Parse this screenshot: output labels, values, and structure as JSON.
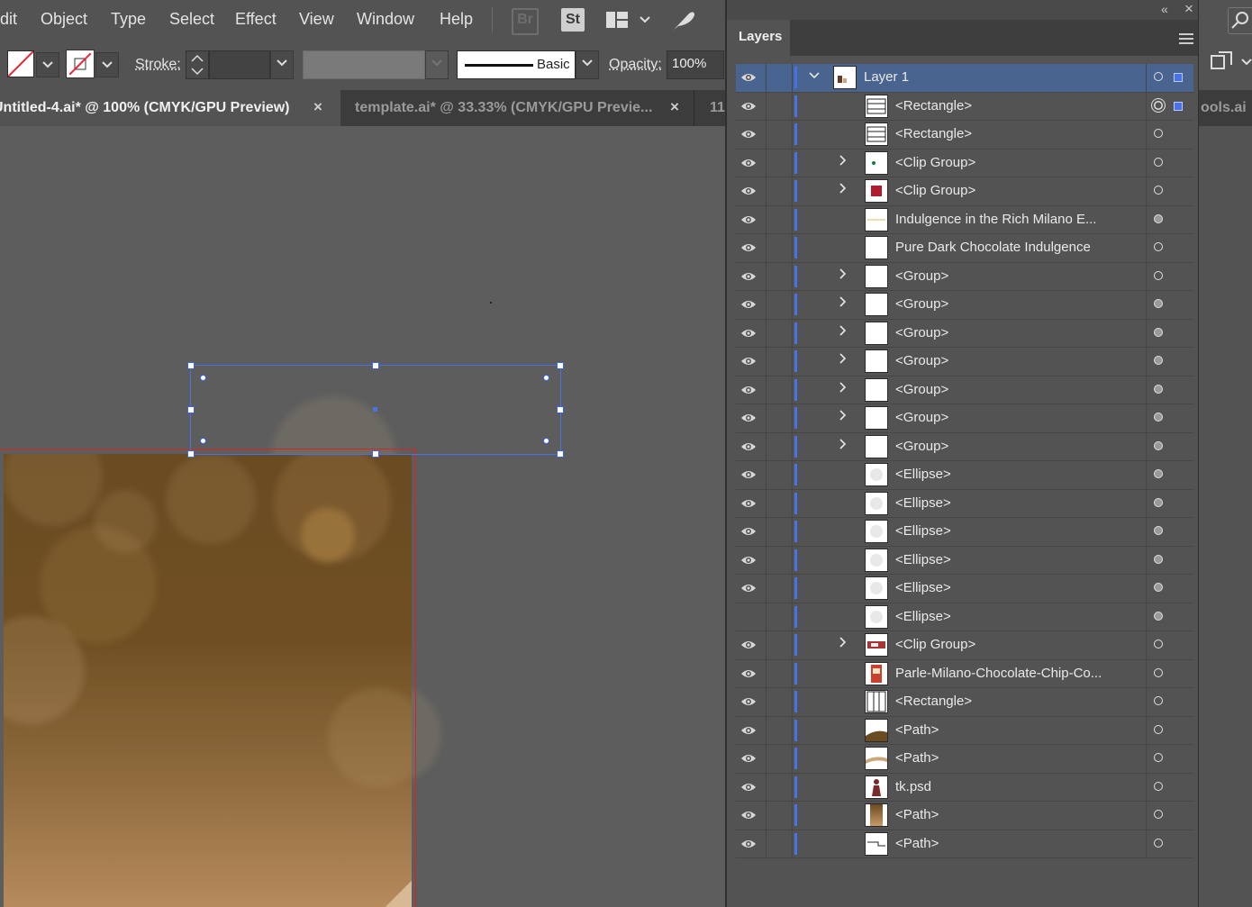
{
  "menu": [
    "dit",
    "Object",
    "Type",
    "Select",
    "Effect",
    "View",
    "Window",
    "Help"
  ],
  "toolbar_icons": {
    "bridge": "Br",
    "stock": "St"
  },
  "control": {
    "stroke_label": "Stroke:",
    "brush_style": "Basic",
    "opacity_label": "Opacity:",
    "opacity_value": "100%"
  },
  "tabs": [
    {
      "label": "Untitled-4.ai* @ 100% (CMYK/GPU Preview)",
      "close": "×"
    },
    {
      "label": "template.ai* @ 33.33% (CMYK/GPU Previe...",
      "close": "×"
    },
    {
      "label": "11"
    }
  ],
  "right_tab_partial": "ools.ai",
  "panel": {
    "title": "Layers",
    "collapse": "«",
    "close": "×",
    "rows": [
      {
        "name": "Layer 1",
        "type": "layer",
        "expanded": true,
        "eye": true,
        "target": "open",
        "selected": true,
        "sel_square": true
      },
      {
        "name": "<Rectangle>",
        "eye": true,
        "target": "double",
        "sel_square": true,
        "thumb": "rect-lines"
      },
      {
        "name": "<Rectangle>",
        "eye": true,
        "target": "open",
        "thumb": "rect-lines"
      },
      {
        "name": "<Clip Group>",
        "eye": true,
        "chev": true,
        "target": "open",
        "thumb": "clip-green"
      },
      {
        "name": "<Clip Group>",
        "eye": true,
        "chev": true,
        "target": "open",
        "thumb": "clip-red"
      },
      {
        "name": "Indulgence in the Rich Milano E...",
        "eye": true,
        "target": "filled",
        "thumb": "line"
      },
      {
        "name": "Pure Dark Chocolate Indulgence",
        "eye": true,
        "target": "open",
        "thumb": "blank"
      },
      {
        "name": "<Group>",
        "eye": true,
        "chev": true,
        "target": "open",
        "thumb": "blank"
      },
      {
        "name": "<Group>",
        "eye": true,
        "chev": true,
        "target": "filled",
        "thumb": "blank"
      },
      {
        "name": "<Group>",
        "eye": true,
        "chev": true,
        "target": "filled",
        "thumb": "blank"
      },
      {
        "name": "<Group>",
        "eye": true,
        "chev": true,
        "target": "filled",
        "thumb": "blank"
      },
      {
        "name": "<Group>",
        "eye": true,
        "chev": true,
        "target": "filled",
        "thumb": "blank"
      },
      {
        "name": "<Group>",
        "eye": true,
        "chev": true,
        "target": "filled",
        "thumb": "blank"
      },
      {
        "name": "<Group>",
        "eye": true,
        "chev": true,
        "target": "filled",
        "thumb": "blank"
      },
      {
        "name": "<Ellipse>",
        "eye": true,
        "target": "filled",
        "thumb": "ellipse"
      },
      {
        "name": "<Ellipse>",
        "eye": true,
        "target": "filled",
        "thumb": "ellipse"
      },
      {
        "name": "<Ellipse>",
        "eye": true,
        "target": "filled",
        "thumb": "ellipse"
      },
      {
        "name": "<Ellipse>",
        "eye": true,
        "target": "filled",
        "thumb": "ellipse"
      },
      {
        "name": "<Ellipse>",
        "eye": true,
        "target": "filled",
        "thumb": "ellipse"
      },
      {
        "name": "<Ellipse>",
        "eye": false,
        "target": "filled",
        "thumb": "ellipse"
      },
      {
        "name": "<Clip Group>",
        "eye": true,
        "chev": true,
        "target": "open",
        "thumb": "clip-pack"
      },
      {
        "name": "Parle-Milano-Chocolate-Chip-Co...",
        "eye": true,
        "target": "open",
        "thumb": "pack"
      },
      {
        "name": "<Rectangle>",
        "eye": true,
        "target": "open",
        "thumb": "rect-vlines"
      },
      {
        "name": "<Path>",
        "eye": true,
        "target": "open",
        "thumb": "path-brown"
      },
      {
        "name": "<Path>",
        "eye": true,
        "target": "open",
        "thumb": "path-tan"
      },
      {
        "name": "tk.psd",
        "eye": true,
        "target": "open",
        "thumb": "figure"
      },
      {
        "name": "<Path>",
        "eye": true,
        "target": "open",
        "thumb": "gradient"
      },
      {
        "name": "<Path>",
        "eye": true,
        "target": "open",
        "thumb": "path-line"
      }
    ]
  },
  "colors": {
    "selection": "#4a72e8",
    "artboard_edge": "#dd2222",
    "bg": "#535353"
  }
}
